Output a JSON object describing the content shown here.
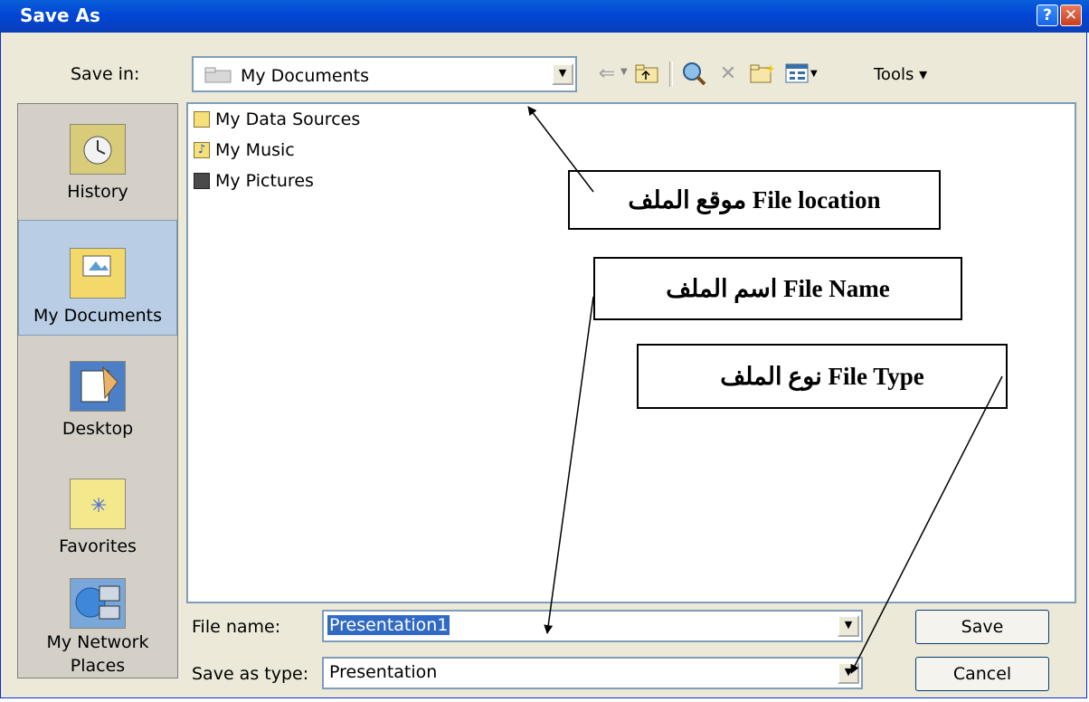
{
  "window": {
    "title": "Save As",
    "help_glyph": "?",
    "close_glyph": "✕"
  },
  "toolbar": {
    "save_in_label": "Save in:",
    "save_in_value": "My Documents",
    "tools_label": "Tools ▾",
    "icons": [
      "back-arrow-icon",
      "up-folder-icon",
      "search-web-icon",
      "delete-icon",
      "new-folder-icon",
      "views-icon"
    ]
  },
  "places": [
    {
      "label": "History",
      "icon": "history-icon"
    },
    {
      "label": "My Documents",
      "icon": "my-documents-icon"
    },
    {
      "label": "Desktop",
      "icon": "desktop-icon"
    },
    {
      "label": "Favorites",
      "icon": "favorites-icon"
    },
    {
      "label_line1": "My Network",
      "label_line2": "Places",
      "icon": "network-places-icon"
    }
  ],
  "files": [
    {
      "name": "My Data Sources",
      "icon": "data-sources-folder-icon"
    },
    {
      "name": "My Music",
      "icon": "music-folder-icon"
    },
    {
      "name": "My Pictures",
      "icon": "pictures-folder-icon"
    }
  ],
  "form": {
    "file_name_label": "File name:",
    "file_name_value": "Presentation1",
    "save_type_label": "Save as type:",
    "save_type_value": "Presentation"
  },
  "buttons": {
    "save": "Save",
    "cancel": "Cancel"
  },
  "annotations": {
    "location": "موقع الملف File location",
    "name": "اسم الملف File Name",
    "type": "نوع الملف File Type"
  },
  "colors": {
    "titlebar": "#0046d5",
    "dialog_bg": "#ece9d8",
    "selection": "#316ac5"
  }
}
